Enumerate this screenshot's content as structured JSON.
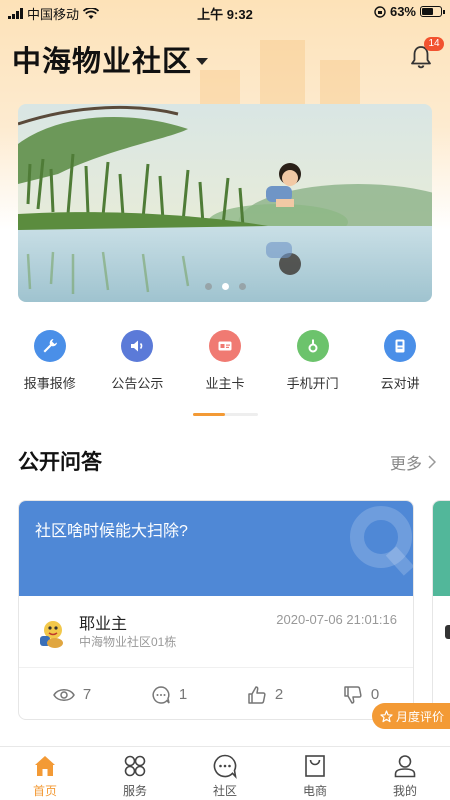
{
  "status_bar": {
    "carrier": "中国移动",
    "time": "上午 9:32",
    "battery": "63%",
    "battery_level": 0.63
  },
  "header": {
    "title": "中海物业社区",
    "notification_count": "14"
  },
  "banner": {
    "slide_count": 3,
    "active_slide": 2
  },
  "quick_actions": [
    {
      "label": "报事报修",
      "icon": "wrench-icon",
      "color": "#4a8fe8"
    },
    {
      "label": "公告公示",
      "icon": "speaker-icon",
      "color": "#4a8fe8"
    },
    {
      "label": "业主卡",
      "icon": "id-card-icon",
      "color": "#f07a72"
    },
    {
      "label": "手机开门",
      "icon": "key-icon",
      "color": "#6cc36c"
    },
    {
      "label": "云对讲",
      "icon": "intercom-icon",
      "color": "#4a8fe8"
    }
  ],
  "qa_section": {
    "title": "公开问答",
    "more": "更多",
    "cards": [
      {
        "question": "社区啥时候能大扫除?",
        "author": "耶业主",
        "address": "中海物业社区01栋",
        "time": "2020-07-06 21:01:16",
        "views": "7",
        "comments": "1",
        "likes": "2",
        "dislikes": "0"
      }
    ]
  },
  "floating": {
    "rate_label": "月度评价"
  },
  "tabbar": [
    {
      "label": "首页",
      "icon": "home-icon",
      "active": true
    },
    {
      "label": "服务",
      "icon": "grid-icon",
      "active": false
    },
    {
      "label": "社区",
      "icon": "chat-icon",
      "active": false
    },
    {
      "label": "电商",
      "icon": "shopping-bag-icon",
      "active": false
    },
    {
      "label": "我的",
      "icon": "person-icon",
      "active": false
    }
  ],
  "colors": {
    "accent": "#f39a35",
    "card_blue": "#4f88d6",
    "header_gradient": "#fde2b8"
  }
}
